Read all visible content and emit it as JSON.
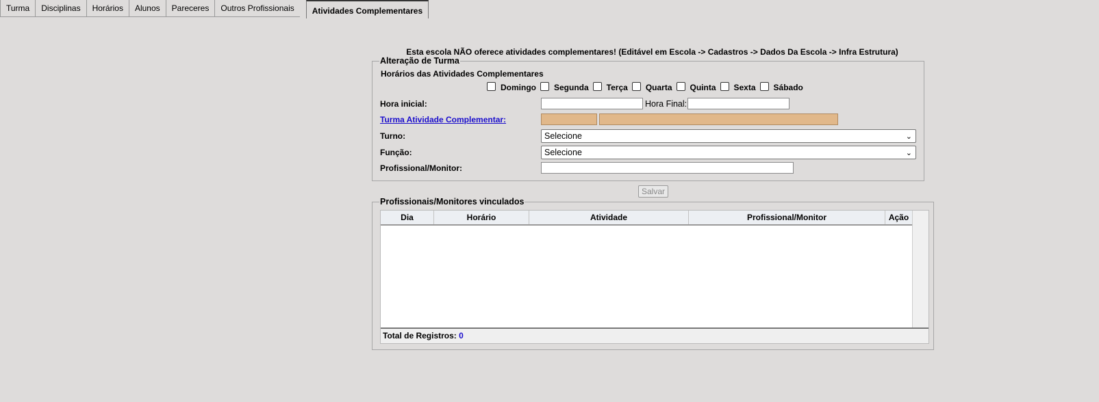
{
  "tabs": [
    {
      "label": "Turma"
    },
    {
      "label": "Disciplinas"
    },
    {
      "label": "Horários"
    },
    {
      "label": "Alunos"
    },
    {
      "label": "Pareceres"
    },
    {
      "label": "Outros Profissionais"
    },
    {
      "label": "Atividades Complementares",
      "active": true
    }
  ],
  "notice": "Esta escola NÃO oferece atividades complementares! (Editável em Escola -> Cadastros -> Dados Da Escola -> Infra Estrutura)",
  "form": {
    "legend": "Alteração de Turma",
    "schedule_title": "Horários das Atividades Complementares",
    "days": [
      "Domingo",
      "Segunda",
      "Terça",
      "Quarta",
      "Quinta",
      "Sexta",
      "Sábado"
    ],
    "start_time_label": "Hora inicial:",
    "start_time_value": "",
    "end_time_label": "Hora Final:",
    "end_time_value": "",
    "class_link_label": "Turma Atividade Complementar:",
    "shift_label": "Turno:",
    "shift_value": "Selecione",
    "function_label": "Função:",
    "function_value": "Selecione",
    "professional_label": "Profissional/Monitor:",
    "professional_value": "",
    "save_label": "Salvar"
  },
  "linked": {
    "legend": "Profissionais/Monitores vinculados",
    "columns": [
      "Dia",
      "Horário",
      "Atividade",
      "Profissional/Monitor",
      "Ação"
    ],
    "rows": [],
    "total_label": "Total de Registros:",
    "total_value": "0"
  }
}
